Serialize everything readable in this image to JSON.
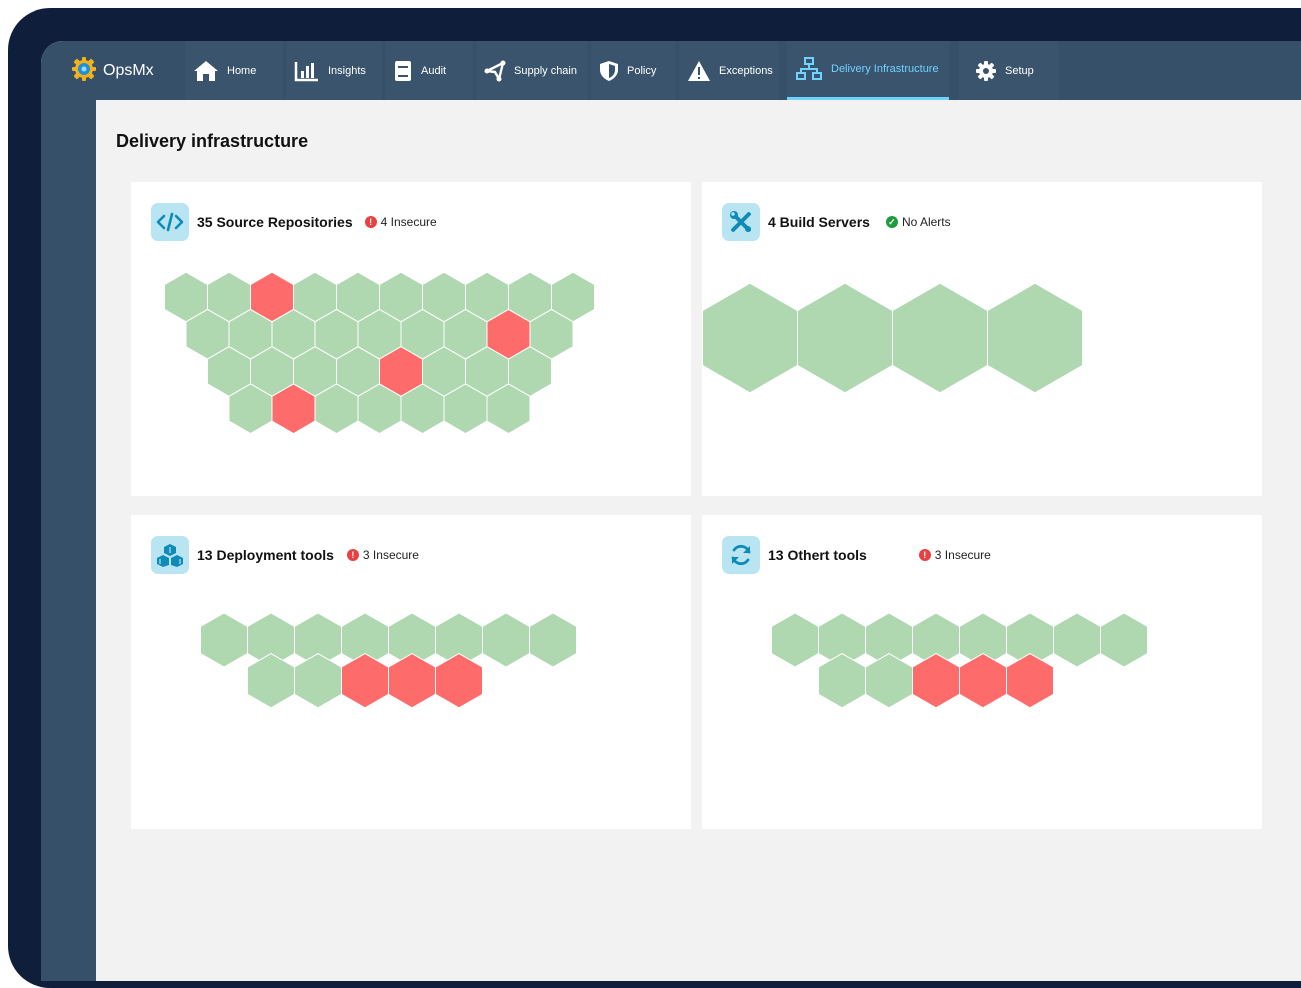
{
  "brand": {
    "name": "OpsMx"
  },
  "nav": [
    {
      "label": "Home",
      "icon": "home-icon"
    },
    {
      "label": "Insights",
      "icon": "bar-chart-icon"
    },
    {
      "label": "Audit",
      "icon": "book-icon"
    },
    {
      "label": "Supply chain",
      "icon": "share-icon"
    },
    {
      "label": "Policy",
      "icon": "shield-icon"
    },
    {
      "label": "Exceptions",
      "icon": "warning-icon"
    },
    {
      "label": "Delivery Infrastructure",
      "icon": "network-icon",
      "active": true
    },
    {
      "label": "Setup",
      "icon": "gear-icon"
    }
  ],
  "page": {
    "title": "Delivery infrastructure"
  },
  "cards": {
    "source": {
      "title": "35 Source Repositories",
      "status": "4 Insecure",
      "status_type": "alert",
      "icon": "code-icon",
      "rows": [
        [
          "ok",
          "ok",
          "bad",
          "ok",
          "ok",
          "ok",
          "ok",
          "ok",
          "ok",
          "ok"
        ],
        [
          "ok",
          "ok",
          "ok",
          "ok",
          "ok",
          "ok",
          "ok",
          "bad",
          "ok"
        ],
        [
          "ok",
          "ok",
          "ok",
          "ok",
          "bad",
          "ok",
          "ok",
          "ok"
        ],
        [
          "ok",
          "bad",
          "ok",
          "ok",
          "ok",
          "ok",
          "ok"
        ]
      ]
    },
    "build": {
      "title": "4 Build Servers",
      "status": "No Alerts",
      "status_type": "ok",
      "icon": "tools-icon",
      "rows": [
        [
          "ok",
          "ok",
          "ok",
          "ok"
        ]
      ]
    },
    "deploy": {
      "title": "13 Deployment tools",
      "status": "3 Insecure",
      "status_type": "alert",
      "icon": "cubes-icon",
      "rows": [
        [
          "ok",
          "ok",
          "ok",
          "ok",
          "ok",
          "ok",
          "ok",
          "ok"
        ],
        [
          "ok",
          "ok",
          "bad",
          "bad",
          "bad"
        ]
      ]
    },
    "other": {
      "title": "13 Othert tools",
      "status": "3 Insecure",
      "status_type": "alert",
      "icon": "sync-icon",
      "rows": [
        [
          "ok",
          "ok",
          "ok",
          "ok",
          "ok",
          "ok",
          "ok",
          "ok"
        ],
        [
          "ok",
          "ok",
          "bad",
          "bad",
          "bad"
        ]
      ]
    }
  },
  "colors": {
    "ok": "#afd8b1",
    "bad": "#fe6b6b",
    "alert_dot": "#e94141",
    "ok_dot": "#1e9b3d",
    "accent": "#6fd3ff"
  }
}
